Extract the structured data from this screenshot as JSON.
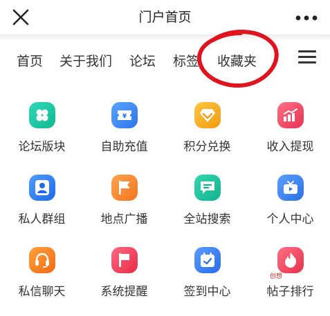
{
  "header": {
    "title": "门户首页"
  },
  "tabs": [
    {
      "label": "首页"
    },
    {
      "label": "关于我们"
    },
    {
      "label": "论坛"
    },
    {
      "label": "标签"
    },
    {
      "label": "收藏夹"
    }
  ],
  "grid": [
    {
      "label": "论坛版块",
      "icon": "clover-icon",
      "color": "#20c7a3"
    },
    {
      "label": "自助充值",
      "icon": "ticket-icon",
      "color": "#3a86f0"
    },
    {
      "label": "积分兑换",
      "icon": "gem-icon",
      "color": "#f5a623"
    },
    {
      "label": "收入提现",
      "icon": "chart-icon",
      "color": "#ee4a6a"
    },
    {
      "label": "私人群组",
      "icon": "user-icon",
      "color": "#2d7ef2"
    },
    {
      "label": "地点广播",
      "icon": "flag-icon",
      "color": "#f68a2e"
    },
    {
      "label": "全站搜索",
      "icon": "chat-icon",
      "color": "#19bfa0"
    },
    {
      "label": "个人中心",
      "icon": "tv-icon",
      "color": "#3b80f2"
    },
    {
      "label": "私信聊天",
      "icon": "headset-icon",
      "color": "#f57f22"
    },
    {
      "label": "系统提醒",
      "icon": "banner-icon",
      "color": "#ee3d5a"
    },
    {
      "label": "签到中心",
      "icon": "calendar-icon",
      "color": "#3b7ef0"
    },
    {
      "label": "帖子排行",
      "icon": "flame-icon",
      "color": "#ef4557"
    }
  ],
  "stamp": "创想"
}
